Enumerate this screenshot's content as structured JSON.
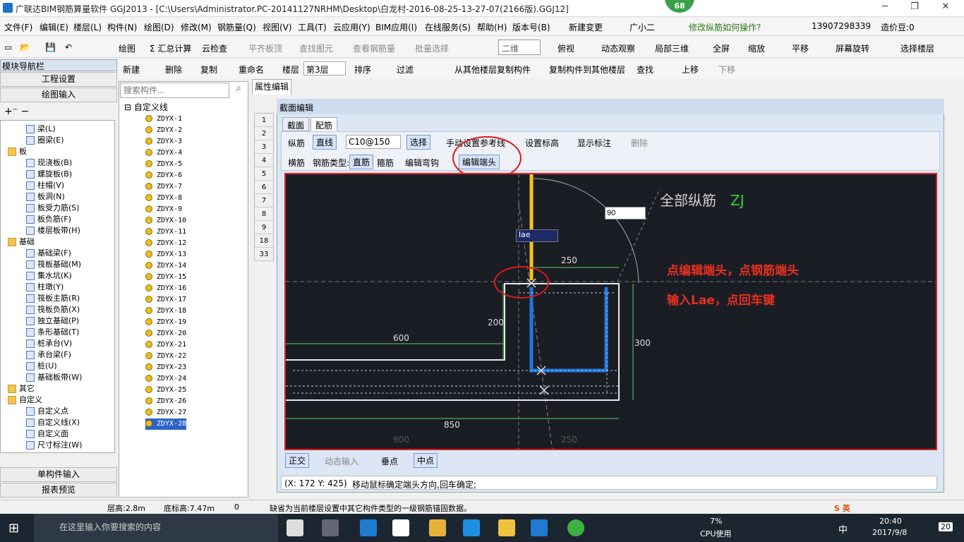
{
  "window": {
    "title": "广联达BIM钢筋算量软件 GGJ2013 - [C:\\Users\\Administrator.PC-20141127NRHM\\Desktop\\白龙村-2016-08-25-13-27-07(2166版).GGJ12]",
    "badge": "68"
  },
  "menu": [
    "文件(F)",
    "编辑(E)",
    "楼层(L)",
    "构件(N)",
    "绘图(D)",
    "修改(M)",
    "钢筋量(Q)",
    "视图(V)",
    "工具(T)",
    "云应用(Y)",
    "BIM应用(I)",
    "在线服务(S)",
    "帮助(H)",
    "版本号(B)",
    "新建变更",
    "广小二",
    "修改纵筋如何操作?",
    "13907298339",
    "造价豆:0"
  ],
  "toolbar1": [
    "绘图",
    "Σ 汇总计算",
    "云检查",
    "平齐板顶",
    "查找图元",
    "查看钢筋量",
    "批量选择",
    "二维",
    "俯视",
    "动态观察",
    "局部三维",
    "全屏",
    "缩放",
    "平移",
    "屏幕旋转",
    "选择楼层"
  ],
  "toolbar2": [
    "新建",
    "删除",
    "复制",
    "重命名",
    "楼层",
    "第3层",
    "排序",
    "过滤",
    "从其他楼层复制构件",
    "复制构件到其他楼层",
    "查找",
    "上移",
    "下移"
  ],
  "nav": {
    "header": "模块导航栏",
    "engineering": "工程设置",
    "drawing": "绘图输入",
    "single": "单构件输入",
    "report": "报表预览",
    "tree": [
      {
        "t": "梁(L)",
        "l": 2,
        "f": false
      },
      {
        "t": "圈梁(E)",
        "l": 2,
        "f": false
      },
      {
        "t": "板",
        "l": 1,
        "f": true
      },
      {
        "t": "现浇板(B)",
        "l": 2,
        "f": false
      },
      {
        "t": "螺旋板(B)",
        "l": 2,
        "f": false
      },
      {
        "t": "柱帽(V)",
        "l": 2,
        "f": false
      },
      {
        "t": "板洞(N)",
        "l": 2,
        "f": false
      },
      {
        "t": "板受力筋(S)",
        "l": 2,
        "f": false
      },
      {
        "t": "板负筋(F)",
        "l": 2,
        "f": false
      },
      {
        "t": "楼层板带(H)",
        "l": 2,
        "f": false
      },
      {
        "t": "基础",
        "l": 1,
        "f": true
      },
      {
        "t": "基础梁(F)",
        "l": 2,
        "f": false
      },
      {
        "t": "筏板基础(M)",
        "l": 2,
        "f": false
      },
      {
        "t": "集水坑(K)",
        "l": 2,
        "f": false
      },
      {
        "t": "柱墩(Y)",
        "l": 2,
        "f": false
      },
      {
        "t": "筏板主筋(R)",
        "l": 2,
        "f": false
      },
      {
        "t": "筏板负筋(X)",
        "l": 2,
        "f": false
      },
      {
        "t": "独立基础(P)",
        "l": 2,
        "f": false
      },
      {
        "t": "条形基础(T)",
        "l": 2,
        "f": false
      },
      {
        "t": "桩承台(V)",
        "l": 2,
        "f": false
      },
      {
        "t": "承台梁(F)",
        "l": 2,
        "f": false
      },
      {
        "t": "桩(U)",
        "l": 2,
        "f": false
      },
      {
        "t": "基础板带(W)",
        "l": 2,
        "f": false
      },
      {
        "t": "其它",
        "l": 1,
        "f": true
      },
      {
        "t": "自定义",
        "l": 1,
        "f": true
      },
      {
        "t": "自定义点",
        "l": 2,
        "f": false
      },
      {
        "t": "自定义线(X)",
        "l": 2,
        "f": false
      },
      {
        "t": "自定义面",
        "l": 2,
        "f": false
      },
      {
        "t": "尺寸标注(W)",
        "l": 2,
        "f": false
      }
    ]
  },
  "list": {
    "placeholder": "搜索构件...",
    "root": "自定义线",
    "items": [
      "ZDYX-1",
      "ZDYX-2",
      "ZDYX-3",
      "ZDYX-4",
      "ZDYX-5",
      "ZDYX-6",
      "ZDYX-7",
      "ZDYX-8",
      "ZDYX-9",
      "ZDYX-10",
      "ZDYX-11",
      "ZDYX-12",
      "ZDYX-13",
      "ZDYX-14",
      "ZDYX-15",
      "ZDYX-16",
      "ZDYX-17",
      "ZDYX-18",
      "ZDYX-19",
      "ZDYX-20",
      "ZDYX-21",
      "ZDYX-22",
      "ZDYX-23",
      "ZDYX-24",
      "ZDYX-25",
      "ZDYX-26",
      "ZDYX-27",
      "ZDYX-28"
    ],
    "selected": "ZDYX-28"
  },
  "props": {
    "tab": "属性编辑",
    "rows": [
      "1",
      "2",
      "3",
      "4",
      "5",
      "6",
      "7",
      "8",
      "9",
      "18",
      "33"
    ]
  },
  "dialog": {
    "title": "截面编辑",
    "tabs": [
      "截面",
      "配筋"
    ],
    "row1": {
      "a": "纵筋",
      "b": "直线",
      "c": "C10@150",
      "d": "选择",
      "e": "手动设置参考线",
      "f": "设置标高",
      "g": "显示标注",
      "h": "删除"
    },
    "row2": {
      "a": "横筋",
      "b": "钢筋类型:",
      "c": "直筋",
      "d": "箍筋",
      "e": "编辑弯钩",
      "f": "编辑端头"
    },
    "canvas": {
      "label": "全部纵筋",
      "code": "ZJ",
      "input": "90",
      "lae": "lae",
      "d250": "250",
      "d200": "200",
      "d600": "600",
      "d300": "300",
      "d850": "850",
      "d600b": "600",
      "d250b": "250",
      "note1": "点编辑端头，点钢筋端头",
      "note2": "输入Lae，点回车键"
    },
    "bottom": [
      "正交",
      "动态输入",
      "垂点",
      "中点"
    ],
    "status": {
      "coord": "(X: 172 Y: 425)",
      "msg": "移动鼠标确定端头方向,回车确定;"
    }
  },
  "appstatus": {
    "a": "层高:2.8m",
    "b": "底标高:7.47m",
    "c": "0",
    "d": "缺省为当前楼层设置中其它构件类型的一级钢筋锚固数据。"
  },
  "taskbar": {
    "search": "在这里输入你要搜索的内容",
    "cpu": "7%",
    "cpulabel": "CPU使用",
    "ime": "中",
    "time": "20:40",
    "date": "2017/9/8",
    "notif": "20"
  },
  "colors": {
    "canvas": "#1a1e24",
    "rebar": "#1f78e0",
    "highlight": "#e01818",
    "note": "#e83020"
  }
}
